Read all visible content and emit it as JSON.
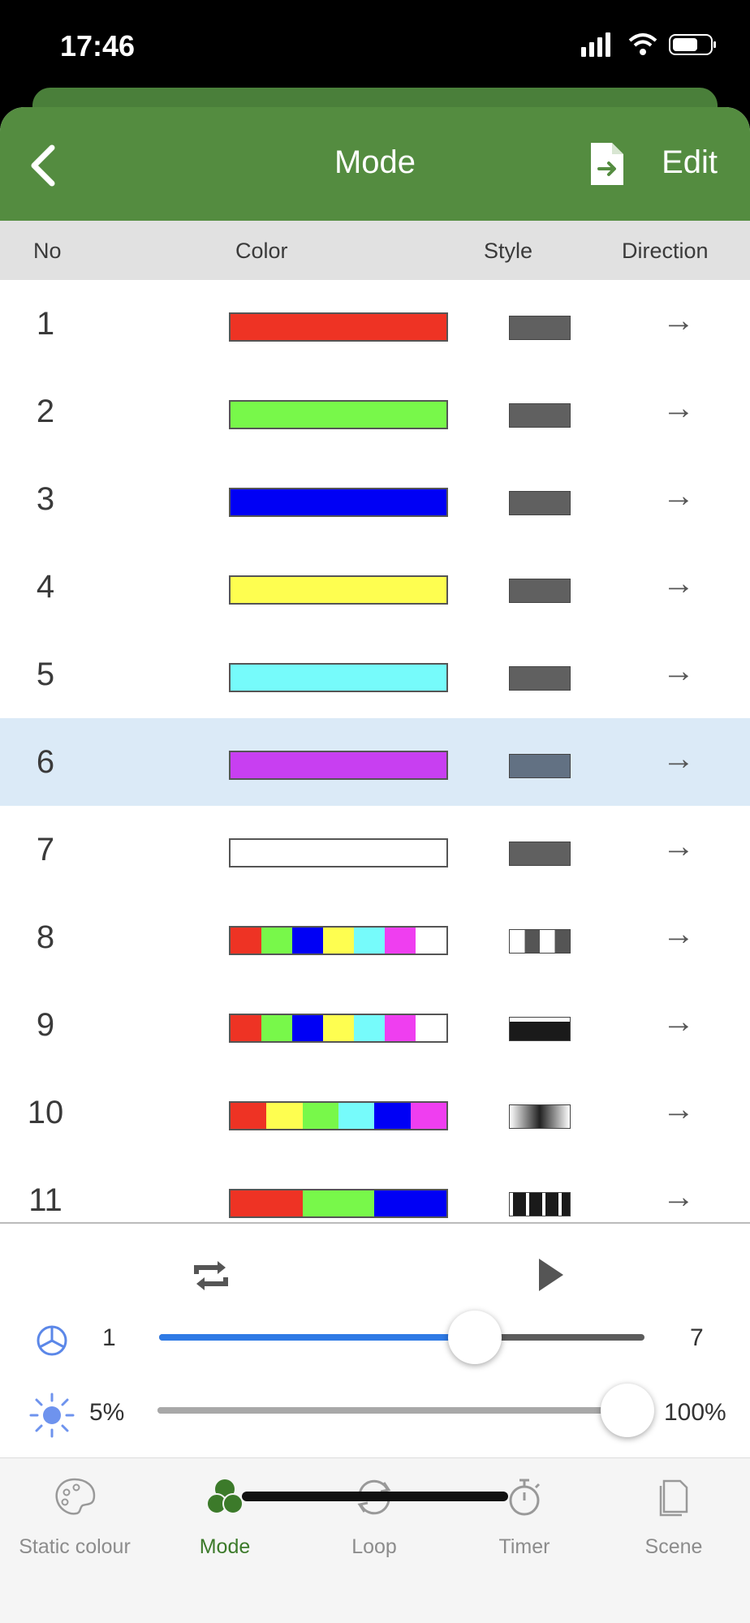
{
  "status": {
    "time": "17:46"
  },
  "header": {
    "title": "Mode",
    "edit_label": "Edit"
  },
  "columns": {
    "no": "No",
    "color": "Color",
    "style": "Style",
    "direction": "Direction"
  },
  "rows": [
    {
      "no": "1",
      "colors": [
        "#ee3324"
      ],
      "style": "solid",
      "direction": "→"
    },
    {
      "no": "2",
      "colors": [
        "#78f84a"
      ],
      "style": "solid",
      "direction": "→"
    },
    {
      "no": "3",
      "colors": [
        "#0000f5"
      ],
      "style": "solid",
      "direction": "→"
    },
    {
      "no": "4",
      "colors": [
        "#fefe50"
      ],
      "style": "solid",
      "direction": "→"
    },
    {
      "no": "5",
      "colors": [
        "#76fbfb"
      ],
      "style": "solid",
      "direction": "→"
    },
    {
      "no": "6",
      "colors": [
        "#c83ff1"
      ],
      "style": "solid",
      "direction": "→",
      "selected": true
    },
    {
      "no": "7",
      "colors": [
        "#ffffff"
      ],
      "style": "solid",
      "direction": "→"
    },
    {
      "no": "8",
      "colors": [
        "#ee3324",
        "#78f84a",
        "#0000f5",
        "#fefe50",
        "#76fbfb",
        "#ef3ef0",
        "#ffffff"
      ],
      "style": "checker",
      "direction": "→"
    },
    {
      "no": "9",
      "colors": [
        "#ee3324",
        "#78f84a",
        "#0000f5",
        "#fefe50",
        "#76fbfb",
        "#ef3ef0",
        "#ffffff"
      ],
      "style": "dark",
      "direction": "→"
    },
    {
      "no": "10",
      "colors": [
        "#ee3324",
        "#fefe50",
        "#78f84a",
        "#76fbfb",
        "#0000f5",
        "#ef3ef0"
      ],
      "style": "gradient",
      "direction": "→"
    },
    {
      "no": "11",
      "colors": [
        "#ee3324",
        "#78f84a",
        "#0000f5"
      ],
      "style": "stripes",
      "direction": "→"
    }
  ],
  "speed": {
    "min_label": "1",
    "max_label": "7",
    "value": 0.65
  },
  "brightness": {
    "min_label": "5%",
    "max_label": "100%",
    "value": 1.0
  },
  "tabs": [
    {
      "label": "Static colour",
      "icon": "palette-icon",
      "active": false
    },
    {
      "label": "Mode",
      "icon": "rgb-circles-icon",
      "active": true
    },
    {
      "label": "Loop",
      "icon": "loop-icon",
      "active": false
    },
    {
      "label": "Timer",
      "icon": "stopwatch-icon",
      "active": false
    },
    {
      "label": "Scene",
      "icon": "document-stack-icon",
      "active": false
    }
  ],
  "colors": {
    "header_green": "#548c40",
    "accent_blue": "#2f7ae5",
    "active_tab_green": "#3c7a2a",
    "selected_row": "#dbeaf7"
  }
}
